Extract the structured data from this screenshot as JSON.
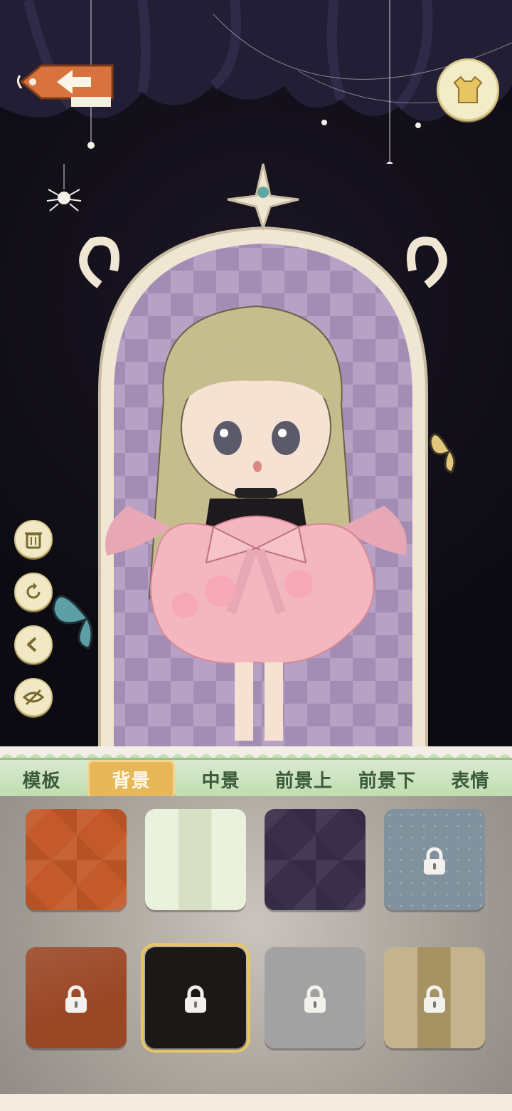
{
  "toolbar": {
    "back_icon": "back-arrow-tag-icon",
    "wardrobe_icon": "dress-icon"
  },
  "side_tools": [
    {
      "name": "delete",
      "icon": "trash-icon"
    },
    {
      "name": "reset",
      "icon": "refresh-icon"
    },
    {
      "name": "undo",
      "icon": "back-chevron-icon"
    },
    {
      "name": "hide",
      "icon": "eye-hidden-icon"
    }
  ],
  "tabs": [
    {
      "label": "模板",
      "active": false
    },
    {
      "label": "背景",
      "active": true
    },
    {
      "label": "中景",
      "active": false
    },
    {
      "label": "前景上",
      "active": false
    },
    {
      "label": "前景下",
      "active": false
    },
    {
      "label": "表情",
      "active": false
    }
  ],
  "backgrounds": [
    {
      "color": "#c45a2a",
      "locked": false,
      "pattern": "argyle"
    },
    {
      "color": "#e3ecd0",
      "locked": false,
      "pattern": "stripes"
    },
    {
      "color": "#3a2f4a",
      "locked": false,
      "pattern": "argyle"
    },
    {
      "color": "#7f929e",
      "locked": true,
      "pattern": "dots"
    },
    {
      "color": "#9a4726",
      "locked": true,
      "pattern": "marble"
    },
    {
      "color": "#1b1818",
      "locked": true,
      "pattern": "plain",
      "selected": true
    },
    {
      "color": "#a2a2a2",
      "locked": true,
      "pattern": "plain"
    },
    {
      "color": "#b09a67",
      "locked": true,
      "pattern": "stripes"
    }
  ],
  "colors": {
    "tab_bar": "#c6dfb5",
    "tab_active": "#e7b75a",
    "mirror_bg": "#a88fb6"
  }
}
